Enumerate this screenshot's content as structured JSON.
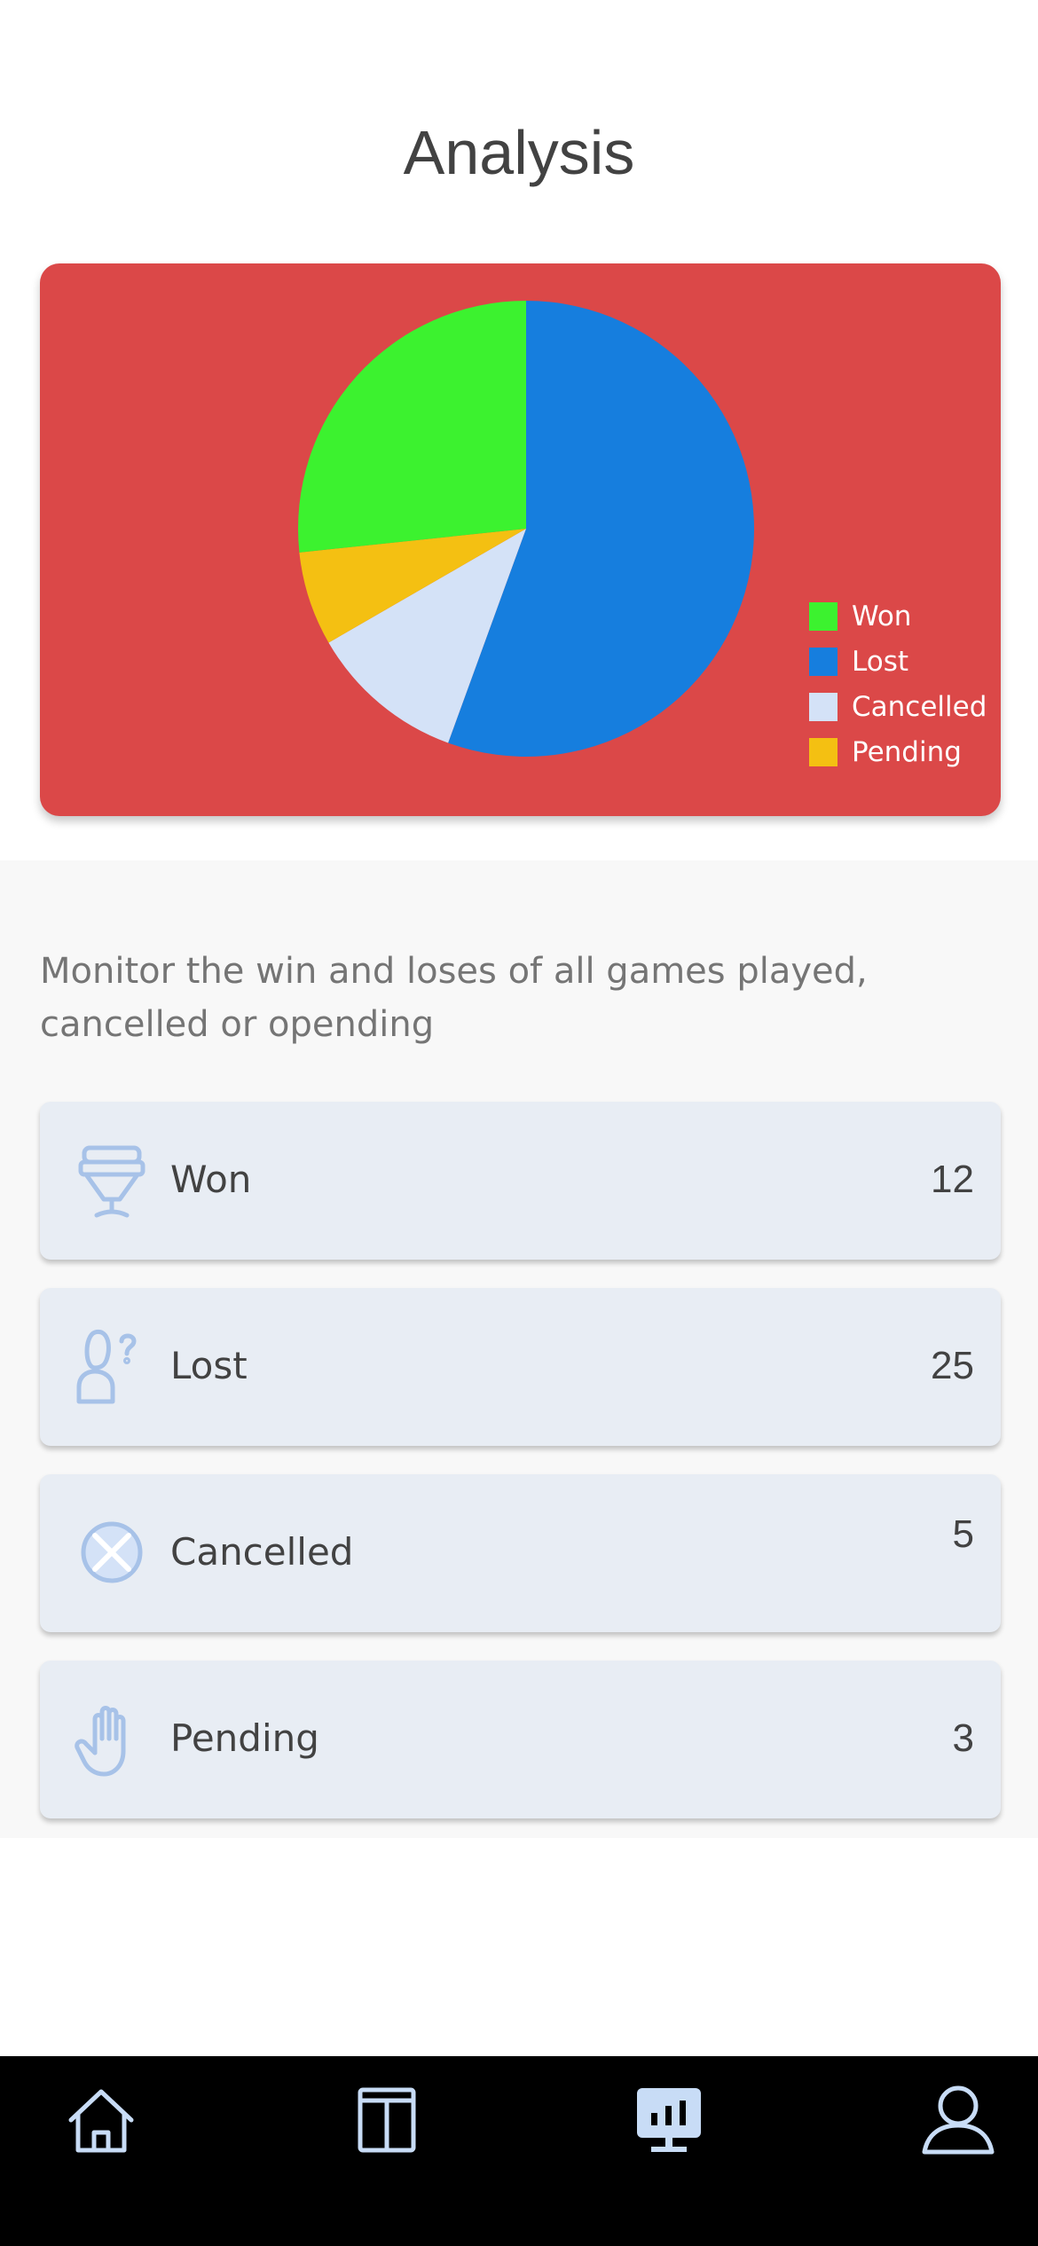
{
  "header": {
    "title": "Analysis"
  },
  "chart_data": {
    "type": "pie",
    "categories": [
      "Won",
      "Lost",
      "Cancelled",
      "Pending"
    ],
    "values": [
      12,
      25,
      5,
      3
    ],
    "slices": [
      {
        "label": "Won",
        "color": "#3cf22f"
      },
      {
        "label": "Lost",
        "color": "#167ede"
      },
      {
        "label": "Cancelled",
        "color": "#d4e2f7"
      },
      {
        "label": "Pending",
        "color": "#f4c012"
      }
    ],
    "legend": [
      "Won",
      "Lost",
      "Cancelled",
      "Pending"
    ],
    "legend_position": "bottom-right",
    "background": "#db4848"
  },
  "description": "Monitor the win and loses of all games played, cancelled or opending",
  "stats": [
    {
      "label": "Won",
      "value": "12",
      "icon": "trophy-icon"
    },
    {
      "label": "Lost",
      "value": "25",
      "icon": "person-question-icon"
    },
    {
      "label": "Cancelled",
      "value": "5",
      "icon": "cancel-circle-icon"
    },
    {
      "label": "Pending",
      "value": "3",
      "icon": "hand-stop-icon"
    }
  ],
  "nav": {
    "items": [
      {
        "name": "home",
        "icon": "home-icon",
        "active": false
      },
      {
        "name": "layout",
        "icon": "layout-icon",
        "active": false
      },
      {
        "name": "analysis",
        "icon": "chart-icon",
        "active": true
      },
      {
        "name": "profile",
        "icon": "user-icon",
        "active": false
      }
    ]
  },
  "colors": {
    "accent": "#db4848",
    "card": "#e8edf4",
    "icon": "#a7c2e8",
    "nav_background": "#000000",
    "nav_icon": "#c8dcf6"
  }
}
